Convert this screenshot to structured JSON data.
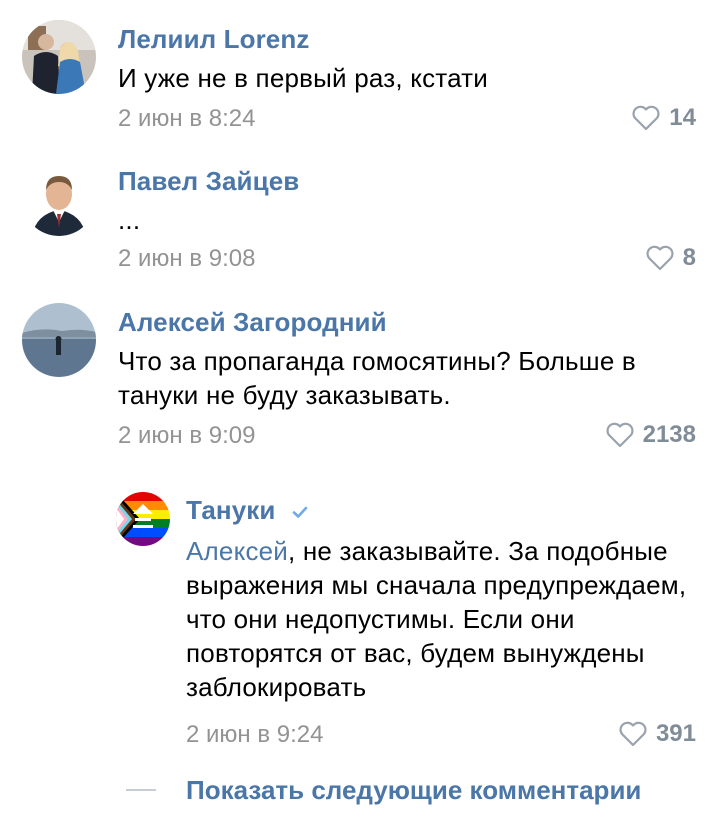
{
  "comments": [
    {
      "author": "Лелиил Lorenz",
      "text": "И уже не в первый раз, кстати",
      "date": "2 июн в 8:24",
      "likes": "14",
      "avatar_icon": "couple-photo-avatar"
    },
    {
      "author": "Павел Зайцев",
      "text": "...",
      "date": "2 июн в 9:08",
      "likes": "8",
      "avatar_icon": "man-portrait-avatar"
    },
    {
      "author": "Алексей Загородний",
      "text": "Что за пропаганда гомосятины? Больше в тануки не буду заказывать.",
      "date": "2 июн в 9:09",
      "likes": "2138",
      "avatar_icon": "seaside-photo-avatar"
    }
  ],
  "reply": {
    "author": "Тануки",
    "verified": true,
    "mention": "Алексей",
    "text": ", не заказывайте. За подобные выражения мы сначала предупреждаем, что они недопустимы. Если они повторятся от вас, будем вынуждены заблокировать",
    "date": "2 июн в 9:24",
    "likes": "391",
    "avatar_icon": "pride-flag-logo-avatar"
  },
  "show_more": {
    "label": "Показать следующие комментарии"
  },
  "colors": {
    "link": "#4a76a8",
    "meta": "#939393",
    "like": "#818c99",
    "divider": "#c5cdd6"
  }
}
